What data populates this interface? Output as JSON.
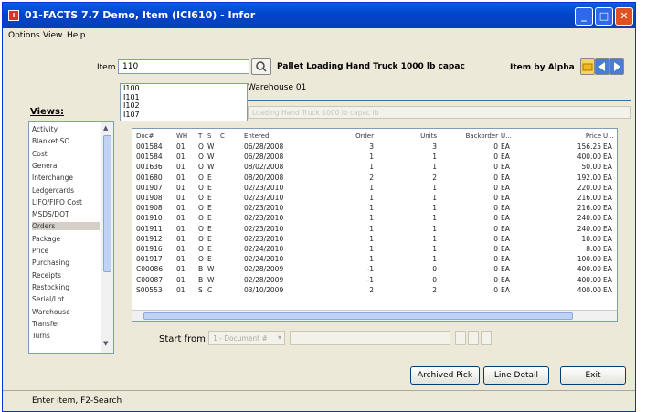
{
  "window": {
    "title": "01-FACTS 7.7 Demo, Item (ICI610) - Infor",
    "min_label": "_",
    "max_label": "□",
    "close_label": "✕"
  },
  "menu": [
    "Options",
    "View",
    "Help"
  ],
  "item": {
    "label": "Item",
    "value": "110",
    "suggestions": [
      "I100",
      "I101",
      "I102",
      "I107"
    ],
    "description": "Pallet Loading Hand Truck 1000 lb capac",
    "warehouse": "Warehouse 01",
    "subtitle": "Loading Hand Truck 1000 lb capac lb",
    "item_by_alpha": "Item by Alpha"
  },
  "views": {
    "heading": "Views:",
    "items": [
      "Activity",
      "Blanket SO",
      "Cost",
      "General",
      "Interchange",
      "Ledgercards",
      "LIFO/FIFO Cost",
      "MSDS/DOT",
      "Orders",
      "Package",
      "Price",
      "Purchasing",
      "Receipts",
      "Restocking",
      "Serial/Lot",
      "Warehouse",
      "Transfer",
      "Turns"
    ],
    "selected": "Orders"
  },
  "table": {
    "columns": [
      "Doc#",
      "WH",
      "T",
      "S",
      "C",
      "Entered",
      "Order",
      "Units",
      "Backorder",
      "U...",
      "Price",
      "U..."
    ],
    "rows": [
      [
        "001584",
        "01",
        "O",
        "W",
        "",
        "06/28/2008",
        "3",
        "3",
        "0",
        "EA",
        "156.25",
        "EA"
      ],
      [
        "001584",
        "01",
        "O",
        "W",
        "",
        "06/28/2008",
        "1",
        "1",
        "0",
        "EA",
        "400.00",
        "EA"
      ],
      [
        "001636",
        "01",
        "O",
        "W",
        "",
        "08/02/2008",
        "1",
        "1",
        "0",
        "EA",
        "50.00",
        "EA"
      ],
      [
        "001680",
        "01",
        "O",
        "E",
        "",
        "08/20/2008",
        "2",
        "2",
        "0",
        "EA",
        "192.00",
        "EA"
      ],
      [
        "001907",
        "01",
        "O",
        "E",
        "",
        "02/23/2010",
        "1",
        "1",
        "0",
        "EA",
        "220.00",
        "EA"
      ],
      [
        "001908",
        "01",
        "O",
        "E",
        "",
        "02/23/2010",
        "1",
        "1",
        "0",
        "EA",
        "216.00",
        "EA"
      ],
      [
        "001908",
        "01",
        "O",
        "E",
        "",
        "02/23/2010",
        "1",
        "1",
        "0",
        "EA",
        "216.00",
        "EA"
      ],
      [
        "001910",
        "01",
        "O",
        "E",
        "",
        "02/23/2010",
        "1",
        "1",
        "0",
        "EA",
        "240.00",
        "EA"
      ],
      [
        "001911",
        "01",
        "O",
        "E",
        "",
        "02/23/2010",
        "1",
        "1",
        "0",
        "EA",
        "240.00",
        "EA"
      ],
      [
        "001912",
        "01",
        "O",
        "E",
        "",
        "02/23/2010",
        "1",
        "1",
        "0",
        "EA",
        "10.00",
        "EA"
      ],
      [
        "001916",
        "01",
        "O",
        "E",
        "",
        "02/24/2010",
        "1",
        "1",
        "0",
        "EA",
        "8.00",
        "EA"
      ],
      [
        "001917",
        "01",
        "O",
        "E",
        "",
        "02/24/2010",
        "1",
        "1",
        "0",
        "EA",
        "100.00",
        "EA"
      ],
      [
        "C00086",
        "01",
        "B",
        "W",
        "",
        "02/28/2009",
        "-1",
        "0",
        "0",
        "EA",
        "400.00",
        "EA"
      ],
      [
        "C00087",
        "01",
        "B",
        "W",
        "",
        "02/28/2009",
        "-1",
        "0",
        "0",
        "EA",
        "400.00",
        "EA"
      ],
      [
        "S00553",
        "01",
        "S",
        "C",
        "",
        "03/10/2009",
        "2",
        "2",
        "0",
        "EA",
        "400.00",
        "EA"
      ]
    ]
  },
  "start_from": {
    "label": "Start from",
    "select_value": "1 - Document #"
  },
  "buttons": {
    "archived_pick": "Archived Pick",
    "line_detail": "Line Detail",
    "exit": "Exit"
  },
  "status": "Enter item, F2-Search"
}
